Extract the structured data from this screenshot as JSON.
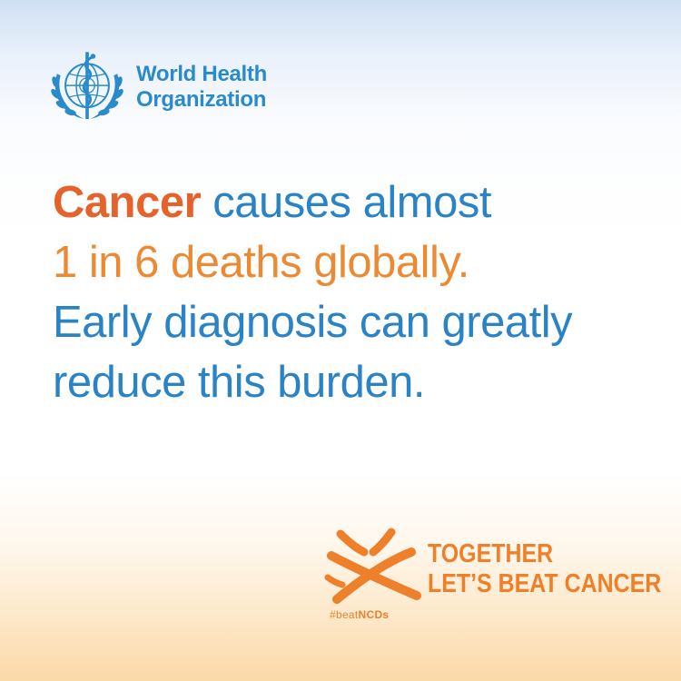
{
  "logo": {
    "line1": "World Health",
    "line2": "Organization",
    "emblem_icon": "who-emblem-icon"
  },
  "message": {
    "line1_highlight": "Cancer",
    "line1_rest": " causes almost",
    "line2": "1 in 6 deaths globally.",
    "line3": "Early diagnosis can greatly",
    "line4": "reduce this burden."
  },
  "campaign": {
    "line1": "TOGETHER",
    "line2": "LET’S BEAT CANCER",
    "hashtag_prefix": "#beat",
    "hashtag_suffix": "NCDs",
    "mark_icon": "cross-swoosh-icon"
  },
  "colors": {
    "blue": "#2a83c5",
    "orange": "#ec8a34",
    "orange_dark": "#e6622b",
    "logo_blue": "#2a8acb"
  }
}
